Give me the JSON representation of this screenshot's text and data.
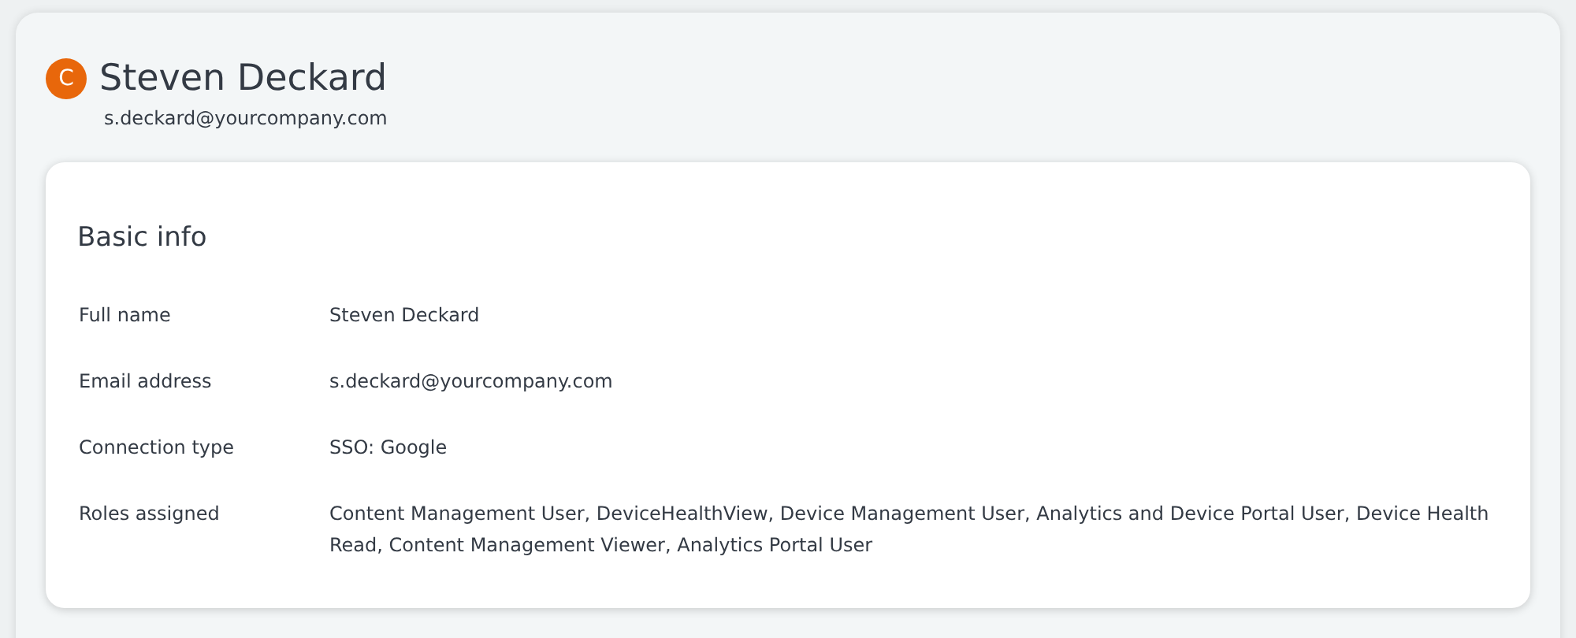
{
  "profile": {
    "avatar_letter": "C",
    "name": "Steven Deckard",
    "email": "s.deckard@yourcompany.com"
  },
  "basic_info": {
    "title": "Basic info",
    "fields": [
      {
        "label": "Full name",
        "value": "Steven Deckard"
      },
      {
        "label": "Email address",
        "value": "s.deckard@yourcompany.com"
      },
      {
        "label": "Connection type",
        "value": "SSO: Google"
      },
      {
        "label": "Roles assigned",
        "value": "Content Management User, DeviceHealthView, Device Management User, Analytics and Device Portal User, Device Health Read, Content Management Viewer, Analytics Portal User"
      }
    ]
  }
}
